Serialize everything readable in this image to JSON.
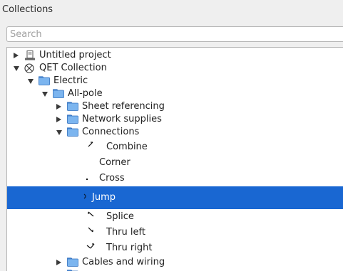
{
  "panel": {
    "title": "Collections"
  },
  "search": {
    "placeholder": "Search",
    "value": ""
  },
  "tree": {
    "items": [
      {
        "label": "Untitled project",
        "icon": "project-icon",
        "expanded": false
      },
      {
        "label": "QET Collection",
        "icon": "collection-icon",
        "expanded": true
      },
      {
        "label": "Electric",
        "icon": "folder-icon",
        "expanded": true
      },
      {
        "label": "All-pole",
        "icon": "folder-icon",
        "expanded": true
      },
      {
        "label": "Sheet referencing",
        "icon": "folder-icon",
        "expanded": false
      },
      {
        "label": "Network supplies",
        "icon": "folder-icon",
        "expanded": false
      },
      {
        "label": "Connections",
        "icon": "folder-icon",
        "expanded": true
      },
      {
        "label": "Combine",
        "icon": "combine-element-icon"
      },
      {
        "label": "Corner",
        "icon": "corner-element-icon"
      },
      {
        "label": "Cross",
        "icon": "cross-element-icon"
      },
      {
        "label": "Jump",
        "icon": "jump-element-icon",
        "selected": true
      },
      {
        "label": "Splice",
        "icon": "splice-element-icon"
      },
      {
        "label": "Thru left",
        "icon": "thru-left-element-icon"
      },
      {
        "label": "Thru right",
        "icon": "thru-right-element-icon"
      },
      {
        "label": "Cables and wiring",
        "icon": "folder-icon",
        "expanded": false
      }
    ]
  },
  "colors": {
    "selection": "#1967d2",
    "folder": "#4a90e2",
    "background": "#efefef"
  }
}
